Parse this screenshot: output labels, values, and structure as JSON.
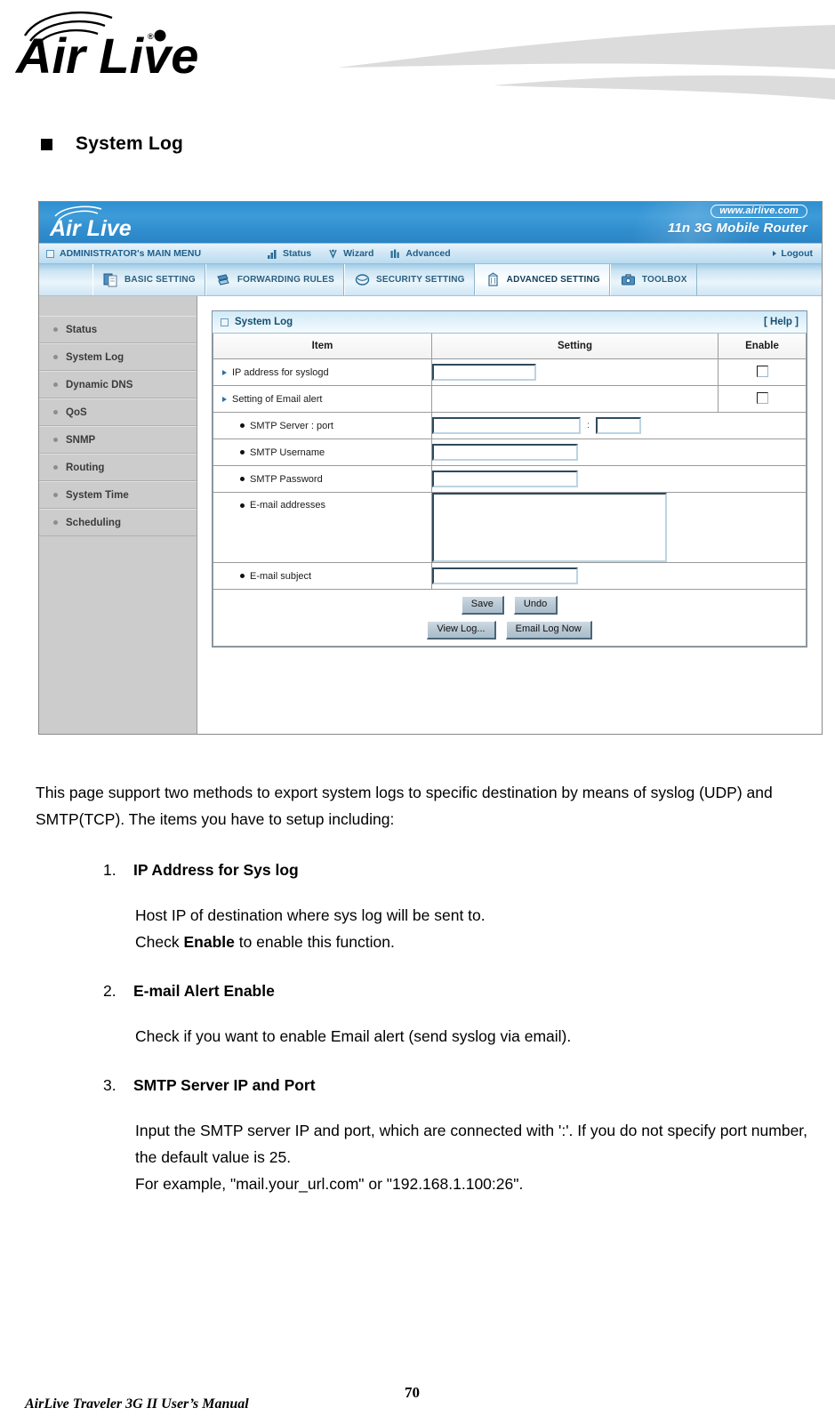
{
  "document": {
    "section_heading": "System Log",
    "paragraph": "This page support two methods to export system logs to specific destination by means of syslog (UDP) and SMTP(TCP). The items you have to setup including:",
    "items": [
      {
        "number": "1.",
        "heading": "IP Address for Sys log",
        "body_line1": "Host IP of destination where sys log will be sent to.",
        "body_line2_pre": "Check ",
        "body_line2_bold": "Enable",
        "body_line2_post": " to enable this function."
      },
      {
        "number": "2.",
        "heading": "E-mail Alert Enable",
        "body_line1": "Check if you want to enable Email alert (send syslog via email).",
        "body_line2_pre": "",
        "body_line2_bold": "",
        "body_line2_post": ""
      },
      {
        "number": "3.",
        "heading": "SMTP Server IP and Port",
        "body_line1": "Input the SMTP server IP and port, which are connected with ':'. If you do not specify port number, the default value is 25.",
        "body_line2_pre": "For example, \"mail.your_url.com\" or \"192.168.1.100:26\".",
        "body_line2_bold": "",
        "body_line2_post": ""
      }
    ],
    "footer": {
      "manual": "AirLive Traveler 3G II User’s Manual",
      "page_number": "70"
    }
  },
  "router_ui": {
    "brand": "Air Live",
    "url_badge": "www.airlive.com",
    "model": "11n 3G Mobile Router",
    "menu": {
      "main_menu": "ADMINISTRATOR's MAIN MENU",
      "items": [
        {
          "label": "Status",
          "icon": "signal-bars-icon"
        },
        {
          "label": "Wizard",
          "icon": "wand-icon"
        },
        {
          "label": "Advanced",
          "icon": "sliders-icon"
        }
      ],
      "logout": "Logout"
    },
    "tabs": [
      {
        "label": "BASIC SETTING",
        "icon": "documents-icon",
        "active": false
      },
      {
        "label": "FORWARDING RULES",
        "icon": "arrows-icon",
        "active": false
      },
      {
        "label": "SECURITY SETTING",
        "icon": "shield-icon",
        "active": false
      },
      {
        "label": "ADVANCED SETTING",
        "icon": "tower-icon",
        "active": true
      },
      {
        "label": "TOOLBOX",
        "icon": "toolbox-icon",
        "active": false
      }
    ],
    "sidebar": [
      {
        "label": "Status"
      },
      {
        "label": "System Log"
      },
      {
        "label": "Dynamic DNS"
      },
      {
        "label": "QoS"
      },
      {
        "label": "SNMP"
      },
      {
        "label": "Routing"
      },
      {
        "label": "System Time"
      },
      {
        "label": "Scheduling"
      }
    ],
    "panel": {
      "title": "System Log",
      "help": "[ Help ]",
      "columns": {
        "item": "Item",
        "setting": "Setting",
        "enable": "Enable"
      },
      "rows": [
        {
          "label": "IP address for syslogd",
          "value": "",
          "enable": false
        },
        {
          "label": "Setting of Email alert",
          "value": "",
          "enable": false
        },
        {
          "label": "SMTP Server : port",
          "value": "",
          "port_value": "",
          "separator": ":"
        },
        {
          "label": "SMTP Username",
          "value": ""
        },
        {
          "label": "SMTP Password",
          "value": ""
        },
        {
          "label": "E-mail addresses",
          "value": ""
        },
        {
          "label": "E-mail subject",
          "value": ""
        }
      ],
      "buttons": [
        {
          "label": "Save"
        },
        {
          "label": "Undo"
        },
        {
          "label": "View Log..."
        },
        {
          "label": "Email Log Now"
        }
      ]
    },
    "colors": {
      "banner_blue": "#2f8fd0",
      "tab_light": "#cce4f3",
      "sidebar_gray": "#cccccc",
      "panel_head": "#cfeaf8"
    }
  }
}
